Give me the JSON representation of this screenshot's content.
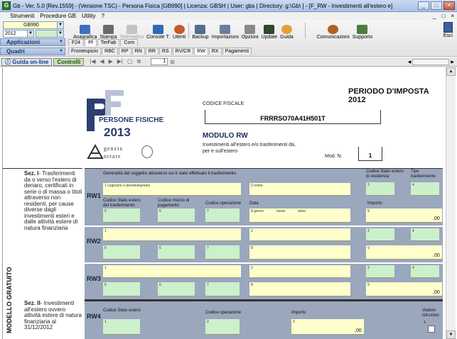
{
  "window": {
    "title": "Gb - Ver. 5.0 [Rev.1559] - (Versione TSC) - Persona Fisica [GB990]   | Licenza: GBSH | User: gbs | Directory: g:\\Gb\\ ] - [F_RW - Investimenti all'estero e]",
    "app_icon": "G",
    "controls": [
      "_",
      "□",
      "×"
    ]
  },
  "menu": {
    "items": [
      "Strumenti",
      "Procedure GB",
      "Utility",
      "?"
    ],
    "right_items": [
      "_",
      "□",
      "×"
    ]
  },
  "selectors": {
    "model": "GB990",
    "year": "2012",
    "applicazioni": "Applicazioni",
    "quadri": "Quadri"
  },
  "toolbar": {
    "tools": [
      {
        "label": "Anagrafica",
        "icon": "registry-icon",
        "color": "#3d6fc1"
      },
      {
        "label": "Stampa",
        "icon": "printer-icon",
        "color": "#555555"
      },
      {
        "label": "Telematico",
        "icon": "telematic-icon",
        "color": "#9a9a9a",
        "disabled": true
      },
      {
        "label": "Console T.",
        "icon": "console-icon",
        "color": "#2f6ab7"
      },
      {
        "label": "Utenti",
        "icon": "users-icon",
        "color": "#c85a2a"
      },
      {
        "label": "Backup",
        "icon": "backup-icon",
        "color": "#556b8f"
      },
      {
        "label": "Importazioni",
        "icon": "import-icon",
        "color": "#6a7da0"
      },
      {
        "label": "Opzioni",
        "icon": "options-icon",
        "color": "#707070"
      },
      {
        "label": "Update",
        "icon": "update-icon",
        "color": "#2c4a2c"
      },
      {
        "label": "Guida",
        "icon": "help-icon",
        "color": "#d98a1a"
      },
      {
        "label": "Comunicazioni",
        "icon": "communications-icon",
        "color": "#b3601f"
      },
      {
        "label": "Supporto",
        "icon": "support-icon",
        "color": "#4d7c3b"
      }
    ],
    "exit_label": "Esci"
  },
  "tabs_row1": {
    "items": [
      "F24",
      "Pf",
      "TerFab",
      "Com"
    ],
    "selected": "Pf"
  },
  "tabs_row2": {
    "items": [
      "Frontespizio",
      "RBC",
      "RP",
      "RN",
      "RR",
      "RS",
      "RV/CR",
      "RW",
      "RX",
      "Pagamenti"
    ],
    "selected": "RW"
  },
  "navbar": {
    "guide_label": "Guida on-line",
    "controls_label": "Controlli",
    "page_value": "1"
  },
  "form": {
    "logo_line1": "PERSONE FISICHE",
    "logo_line2": "2013",
    "agency_line1": "genzia",
    "agency_line2": "ntrate",
    "period": "PERIODO D'IMPOSTA 2012",
    "cf_label": "CODICE FISCALE",
    "cf_value": "FRRRSO70A41H501T",
    "module_title": "MODULO RW",
    "module_subtitle": "Investimenti all'estero e/o trasferimenti da, per e sull'estero",
    "mod_n_label": "Mod. N.",
    "mod_n_value": "1",
    "vertical_label": "MODELLO GRATUITO",
    "sez1_title": "Sez. I",
    "sez1_text": "- Trasferimenti da o verso l'estero di denaro, certificati in serie o di massa o titoli attraverso non residenti, per cause diverse dagli investimenti esteri e dalle attività estere di natura finanziaria",
    "sez2_title": "Sez. II",
    "sez2_text": "- Investimenti all'estero ovvero attività estere di natura finanziaria al 31/12/2012",
    "header_generalita": "Generalità del soggetto attraverso cui è stato effettuato il trasferimento",
    "header_stato_residenza": "Codice Stato estero di residenza",
    "header_tipo": "Tipo trasferimento",
    "rows": [
      {
        "tag": "RW1",
        "f1_text": "1 cognome o denominazione",
        "f2_text": "2 nome",
        "f3": "3",
        "f4": "4",
        "lbl_stato": "Codice Stato estero del trasferimento",
        "lbl_mezzo": "Codice mezzo di pagamento",
        "lbl_operazione": "Codice operazione",
        "lbl_data": "Data",
        "lbl_importo": "Importo",
        "f5": "5",
        "f6": "6",
        "f7": "7",
        "f8_text": "8 giorno",
        "f8_mese": "mese",
        "f8_anno": "anno",
        "f9": "9",
        "decimals": ",00"
      },
      {
        "tag": "RW2",
        "f1": "1",
        "f2": "2",
        "f3": "3",
        "f4": "4",
        "f5": "5",
        "f6": "6",
        "f7": "7",
        "f8": "8",
        "f9": "9",
        "decimals": ",00"
      },
      {
        "tag": "RW3",
        "f1": "1",
        "f2": "2",
        "f3": "3",
        "f4": "4",
        "f5": "5",
        "f6": "6",
        "f7": "7",
        "f8": "8",
        "f9": "9",
        "decimals": ",00"
      },
      {
        "tag": "RW4",
        "lbl_stato": "Codice Stato estero",
        "lbl_operazione": "Codice operazione",
        "lbl_importo": "Importo",
        "lbl_vedere": "Vedere istruzioni",
        "f1": "1",
        "f2": "2",
        "f3": "3",
        "f4": "4",
        "decimals": ",00"
      }
    ]
  }
}
